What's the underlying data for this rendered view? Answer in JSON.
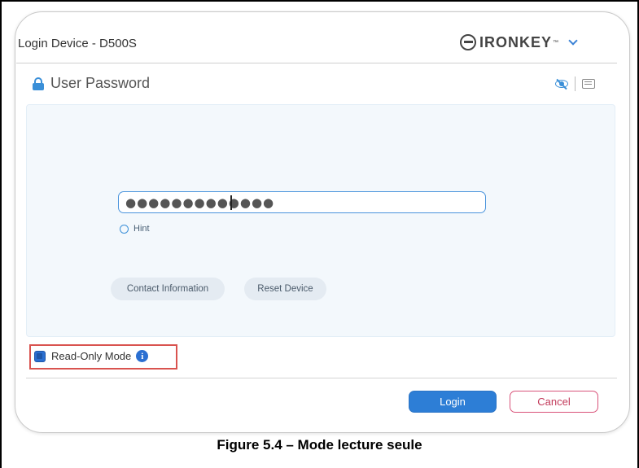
{
  "window": {
    "title": "Login Device - D500S",
    "brand": {
      "name": "IRONKEY",
      "tm": "™"
    }
  },
  "section": {
    "title": "User Password",
    "icons": [
      "lock-icon",
      "eye-slash-icon",
      "keyboard-icon"
    ]
  },
  "password": {
    "value": "●●●●●●●●●●●●●"
  },
  "hint": {
    "label": "Hint"
  },
  "actions": {
    "contact_label": "Contact Information",
    "reset_label": "Reset Device"
  },
  "read_only": {
    "label": "Read-Only Mode",
    "checked": true,
    "info_glyph": "i"
  },
  "footer": {
    "login_label": "Login",
    "cancel_label": "Cancel"
  },
  "caption": "Figure 5.4 – Mode lecture seule",
  "colors": {
    "accent": "#2d7ed6",
    "panel_bg": "#f3f8fc",
    "cancel_red": "#c23a5a",
    "highlight_red": "#d9534f"
  }
}
